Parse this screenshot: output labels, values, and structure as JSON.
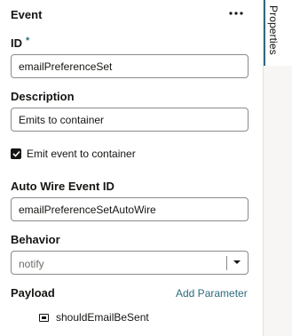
{
  "panel": {
    "title": "Event",
    "more_icon": "more-horizontal-icon"
  },
  "side_tab": {
    "label": "Properties"
  },
  "fields": {
    "id": {
      "label": "ID",
      "required_mark": "*",
      "value": "emailPreferenceSet"
    },
    "description": {
      "label": "Description",
      "value": "Emits to container"
    },
    "emit": {
      "checked": true,
      "label": "Emit event to container"
    },
    "auto_wire": {
      "label": "Auto Wire Event ID",
      "value": "emailPreferenceSetAutoWire"
    },
    "behavior": {
      "label": "Behavior",
      "placeholder": "notify"
    }
  },
  "payload": {
    "label": "Payload",
    "add_label": "Add Parameter",
    "items": [
      {
        "icon": "object-icon",
        "name": "shouldEmailBeSent"
      }
    ]
  },
  "colors": {
    "accent": "#2c6b7e",
    "text": "#161513",
    "border": "#8c8a87",
    "rail": "#f7f6f4"
  }
}
